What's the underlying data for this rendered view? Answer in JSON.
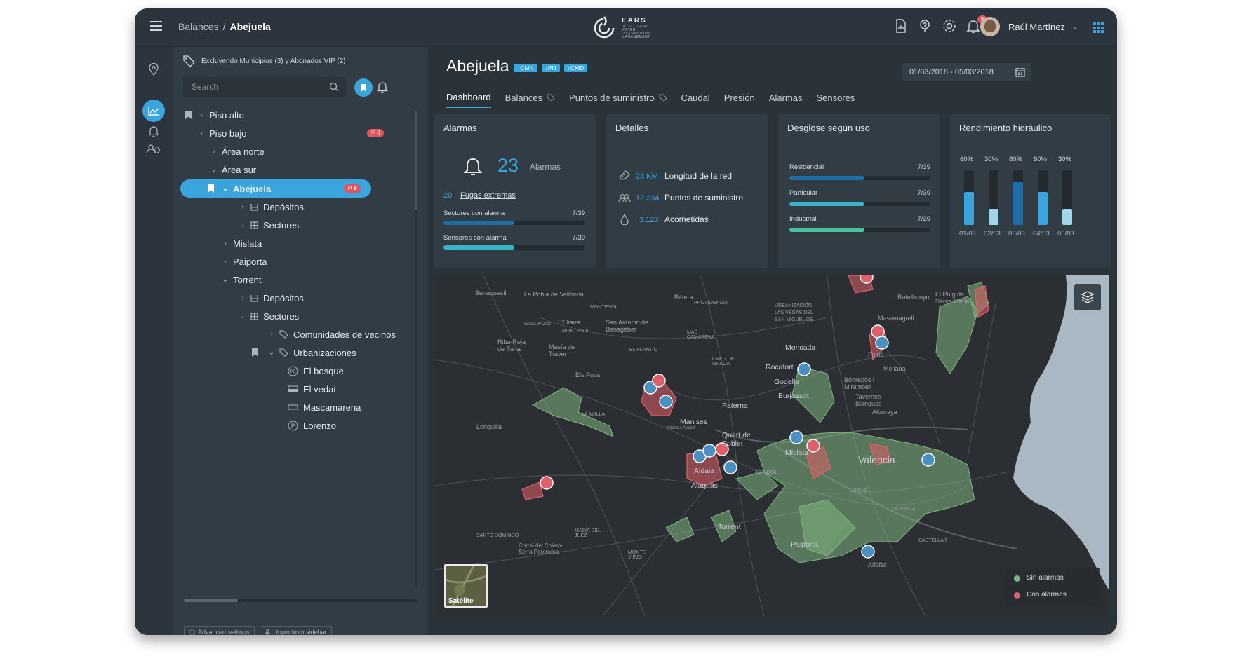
{
  "header": {
    "breadcrumb_parent": "Balances",
    "breadcrumb_sep": "/",
    "breadcrumb_current": "Abejuela",
    "logo_name": "EARS",
    "logo_tagline": "INTELLIGENT WATER DISTRIBUTION MANAGEMENT",
    "notifications_count": "8",
    "user_name": "Raúl Martínez"
  },
  "sidebar": {
    "filter_text": "Excluyendo Municipios (3) y Abonados VIP (2)",
    "search_placeholder": "Search",
    "tree": [
      {
        "label": "Piso alto"
      },
      {
        "label": "Piso bajo",
        "badge": "8"
      },
      {
        "label": "Área norte"
      },
      {
        "label": "Área sur"
      },
      {
        "label": "Abejuela",
        "badge": "8"
      },
      {
        "label": "Depósitos"
      },
      {
        "label": "Sectores"
      },
      {
        "label": "Mislata"
      },
      {
        "label": "Paiporta"
      },
      {
        "label": "Torrent"
      },
      {
        "label": "Depósitos"
      },
      {
        "label": "Sectores"
      },
      {
        "label": "Comunidades de vecinos"
      },
      {
        "label": "Urbanizaciones"
      },
      {
        "label": "El bosque"
      },
      {
        "label": "El vedat"
      },
      {
        "label": "Mascamarena"
      },
      {
        "label": "Lorenzo"
      }
    ],
    "advanced_settings": "Advanced settings",
    "unpin": "Unpin from sidebar"
  },
  "main": {
    "title": "Abejuela",
    "chips": [
      "↑CMN",
      "↓PN",
      "↑CMD"
    ],
    "date_range": "01/03/2018 - 05/03/2018",
    "tabs": [
      "Dashboard",
      "Balances",
      "Puntos de suministro",
      "Caudal",
      "Presión",
      "Alarmas",
      "Sensores"
    ]
  },
  "alarmas": {
    "title": "Alarmas",
    "count": "23",
    "count_label": "Alarmas",
    "fugas_count": "20",
    "fugas_label": "Fugas extremas",
    "bars": [
      {
        "label": "Sectores con alarma",
        "value": "7/39",
        "fraction": 0.5
      },
      {
        "label": "Sensores con alarma",
        "value": "7/39",
        "fraction": 0.5
      }
    ]
  },
  "detalles": {
    "title": "Detalles",
    "rows": [
      {
        "value": "23 KM",
        "label": "Longitud de la red"
      },
      {
        "value": "12.234",
        "label": "Puntos de suministro"
      },
      {
        "value": "3.123",
        "label": "Acometidas"
      }
    ]
  },
  "desglose": {
    "title": "Desglose según uso",
    "bars": [
      {
        "label": "Residencial",
        "value": "7/39",
        "fraction": 0.53,
        "color": "#1e6ea8"
      },
      {
        "label": "Particular",
        "value": "7/39",
        "fraction": 0.53,
        "color": "#3ab5c8"
      },
      {
        "label": "Industrial",
        "value": "7/39",
        "fraction": 0.53,
        "color": "#49c0a0"
      }
    ]
  },
  "rendimiento": {
    "title": "Rendimiento hidráulico",
    "bars": [
      {
        "pct": "60%",
        "date": "01/03",
        "fraction": 0.6,
        "color": "#3aa4dc"
      },
      {
        "pct": "30%",
        "date": "02/03",
        "fraction": 0.3,
        "color": "#9fd6ea"
      },
      {
        "pct": "80%",
        "date": "03/03",
        "fraction": 0.8,
        "color": "#1e6ea8"
      },
      {
        "pct": "60%",
        "date": "04/03",
        "fraction": 0.6,
        "color": "#3aa4dc"
      },
      {
        "pct": "30%",
        "date": "05/03",
        "fraction": 0.3,
        "color": "#9fd6ea"
      }
    ]
  },
  "map": {
    "legend_ok": "Sin alarmas",
    "legend_alarm": "Con alarmas",
    "satellite_label": "Satélite",
    "places": [
      "Benaguasil",
      "La Pobla de Vallbona",
      "Bétera",
      "Rafelbunyol",
      "El Puig de Santa Maria",
      "MONTESOL",
      "PROVIDENCIA",
      "URBANIZACIÓN",
      "LAS VEGAS DEL",
      "SAN MIGUEL DE",
      "GALLIPONT",
      "L'Eliana",
      "San Antonio de Benagéber",
      "MONTESOL",
      "MAS CAMARENA",
      "Masamagrell",
      "Riba-Roja de Túria",
      "Masía de Traver",
      "EL PLANTÍO",
      "CREU DE GRÀCIA",
      "Moncada",
      "Rocafort",
      "Godella",
      "Foios",
      "Meliana",
      "Els Pous",
      "Burjassot",
      "Bonrepòs i Mirambell",
      "Tavernes Blanques",
      "Alboraya",
      "Paterna",
      "Manises",
      "Valencia Airport",
      "Quart de Poblet",
      "Loriguilla",
      "LA MALLA",
      "Mislata",
      "Aldaia",
      "Alaquàs",
      "Xirivella",
      "Valencia",
      "Torrent",
      "Paiporta",
      "MASÍA DEL JUEZ",
      "Corral del Colero-Serra Perenxisa",
      "MONTE VIEJO",
      "CASTELLAR",
      "Alfafar",
      "SANTO DOMINGO",
      "JESÚS",
      "LA PUNTA"
    ]
  }
}
